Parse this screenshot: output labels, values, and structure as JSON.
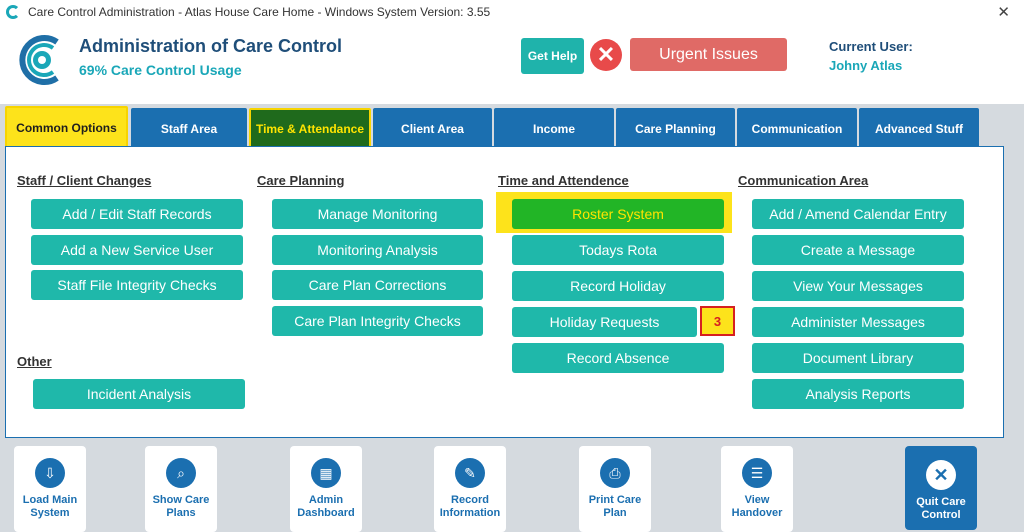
{
  "window": {
    "title": "Care Control Administration - Atlas House Care Home - Windows System Version: 3.55",
    "close_glyph": "✕"
  },
  "header": {
    "app_title": "Administration of Care Control",
    "usage": "69% Care Control Usage",
    "help_label": "Get Help",
    "urgent_label": "Urgent Issues",
    "user_label": "Current User:",
    "user_name": "Johny Atlas"
  },
  "tabs": [
    {
      "label": "Common Options"
    },
    {
      "label": "Staff Area"
    },
    {
      "label": "Time & Attendance"
    },
    {
      "label": "Client Area"
    },
    {
      "label": "Income"
    },
    {
      "label": "Care Planning"
    },
    {
      "label": "Communication"
    },
    {
      "label": "Advanced Stuff"
    }
  ],
  "sections": {
    "staff_client": {
      "title": "Staff / Client Changes",
      "buttons": [
        "Add / Edit Staff Records",
        "Add a New Service User",
        "Staff File Integrity Checks"
      ]
    },
    "other": {
      "title": "Other",
      "buttons": [
        "Incident Analysis"
      ]
    },
    "care_planning": {
      "title": "Care Planning",
      "buttons": [
        "Manage Monitoring",
        "Monitoring Analysis",
        "Care Plan Corrections",
        "Care Plan Integrity Checks"
      ]
    },
    "time": {
      "title": "Time and Attendence",
      "buttons": [
        "Roster System",
        "Todays Rota",
        "Record Holiday",
        "Holiday Requests",
        "Record Absence"
      ],
      "holiday_badge": "3"
    },
    "communication": {
      "title": "Communication Area",
      "buttons": [
        "Add / Amend Calendar Entry",
        "Create a Message",
        "View Your Messages",
        "Administer Messages",
        "Document Library",
        "Analysis Reports"
      ]
    }
  },
  "bottom": {
    "tiles": [
      {
        "l1": "Load Main",
        "l2": "System",
        "icon": "load-icon"
      },
      {
        "l1": "Show Care",
        "l2": "Plans",
        "icon": "search-doc-icon"
      },
      {
        "l1": "Admin",
        "l2": "Dashboard",
        "icon": "dashboard-icon"
      },
      {
        "l1": "Record",
        "l2": "Information",
        "icon": "edit-icon"
      },
      {
        "l1": "Print Care",
        "l2": "Plan",
        "icon": "printer-icon"
      },
      {
        "l1": "View",
        "l2": "Handover",
        "icon": "list-icon"
      }
    ],
    "quit": {
      "l1": "Quit Care",
      "l2": "Control"
    }
  },
  "colors": {
    "teal": "#1fb8aa",
    "blue": "#1b6fb0",
    "highlight": "#fde31b",
    "urgent": "#e06a66"
  }
}
